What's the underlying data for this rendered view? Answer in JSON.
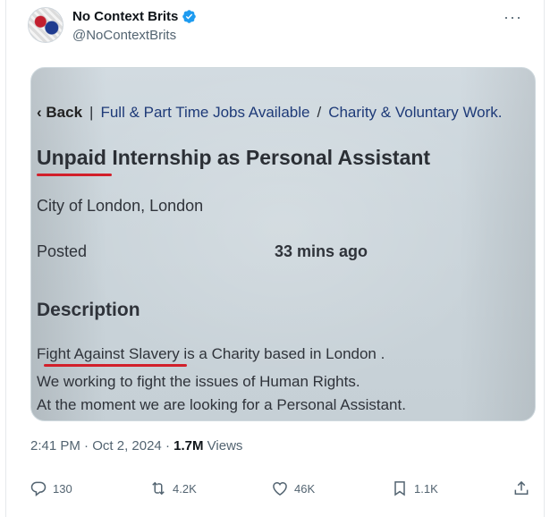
{
  "author": {
    "display_name": "No Context Brits",
    "handle": "@NoContextBrits"
  },
  "more_menu_glyph": "···",
  "image": {
    "breadcrumb": {
      "back": "Back",
      "separator1": "|",
      "item1": "Full & Part Time Jobs Available",
      "separator2": "/",
      "item2": "Charity & Voluntary Work."
    },
    "title": "Unpaid Internship as Personal Assistant",
    "location": "City of London, London",
    "posted_label": "Posted",
    "posted_value": "33 mins ago",
    "description_heading": "Description",
    "description_lines": [
      "Fight Against Slavery is a Charity based in London .",
      "We working to fight the issues of Human Rights.",
      "At the moment we are looking for a Personal Assistant."
    ]
  },
  "meta": {
    "time": "2:41 PM",
    "dot1": "·",
    "date": "Oct 2, 2024",
    "dot2": "·",
    "views_count": "1.7M",
    "views_label": "Views"
  },
  "actions": {
    "replies": "130",
    "reposts": "4.2K",
    "likes": "46K",
    "bookmarks": "1.1K"
  },
  "colors": {
    "verified": "#1d9bf0",
    "highlight_underline": "#d21f2a",
    "secondary_text": "#536471"
  },
  "icons": [
    "verified-badge-icon",
    "more-icon",
    "reply-icon",
    "repost-icon",
    "like-icon",
    "bookmark-icon",
    "share-icon"
  ]
}
